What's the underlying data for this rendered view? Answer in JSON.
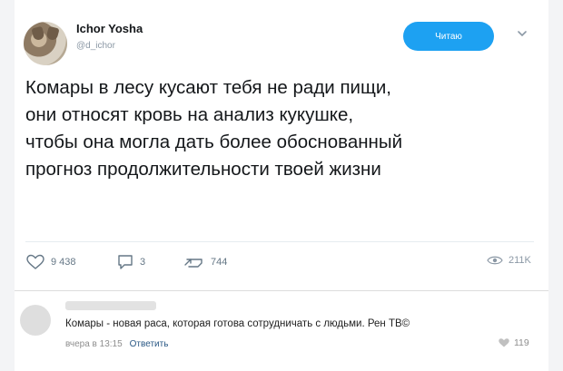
{
  "tweet": {
    "author": {
      "display_name": "Ichor Yosha",
      "handle": "@d_ichor"
    },
    "follow_label": "Читаю",
    "text_lines": [
      "Комары в лесу кусают тебя не ради пищи,",
      "они относят кровь на анализ кукушке,",
      "чтобы она могла дать более обоснованный",
      "прогноз продолжительности твоей жизни"
    ],
    "actions": {
      "likes": "9 438",
      "replies": "3",
      "retweets": "744",
      "views": "211K"
    }
  },
  "comment": {
    "text": "Комары - новая раса, которая готова сотрудничать с людьми. Рен ТВ©",
    "time": "вчера в 13:15",
    "reply_label": "Ответить",
    "likes": "119"
  },
  "colors": {
    "accent": "#1da1f2",
    "text": "#14171a",
    "muted": "#657786",
    "link": "#2a5885"
  },
  "icons": [
    "avatar-image",
    "chevron-down-icon",
    "heart-icon",
    "reply-icon",
    "retweet-icon",
    "views-icon",
    "comment-heart-icon"
  ]
}
